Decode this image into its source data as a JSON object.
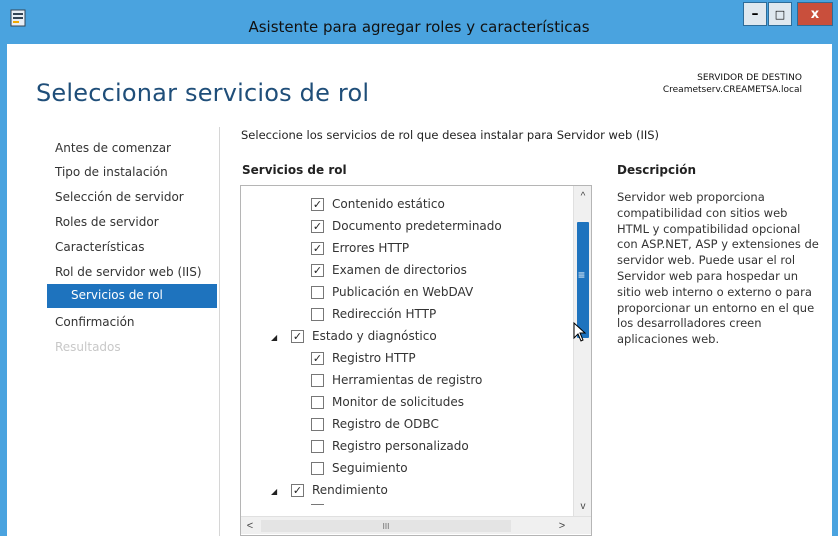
{
  "window": {
    "title": "Asistente para agregar roles y características",
    "minimize": "–",
    "maximize": "□",
    "close": "x"
  },
  "header": {
    "page_title": "Seleccionar servicios de rol",
    "destination_label": "SERVIDOR DE DESTINO",
    "destination_server": "Creametserv.CREAMETSA.local"
  },
  "nav": {
    "items": [
      {
        "label": "Antes de comenzar"
      },
      {
        "label": "Tipo de instalación"
      },
      {
        "label": "Selección de servidor"
      },
      {
        "label": "Roles de servidor"
      },
      {
        "label": "Características"
      },
      {
        "label": "Rol de servidor web (IIS)"
      },
      {
        "label": "Servicios de rol"
      },
      {
        "label": "Confirmación"
      },
      {
        "label": "Resultados"
      }
    ],
    "selected": "Servicios de rol"
  },
  "main": {
    "instruction": "Seleccione los servicios de rol que desea instalar para Servidor web (IIS)",
    "list_header": "Servicios de rol",
    "description_header": "Descripción",
    "description": "Servidor web proporciona compatibilidad con sitios web HTML y compatibilidad opcional con ASP.NET, ASP y extensiones de servidor web. Puede usar el rol Servidor web para hospedar un sitio web interno o externo o para proporcionar un entorno en el que los desarrolladores creen aplicaciones web."
  },
  "tree": {
    "rows": [
      {
        "label": "Contenido estático",
        "checked": true,
        "level": 2
      },
      {
        "label": "Documento predeterminado",
        "checked": true,
        "level": 2
      },
      {
        "label": "Errores HTTP",
        "checked": true,
        "level": 2
      },
      {
        "label": "Examen de directorios",
        "checked": true,
        "level": 2
      },
      {
        "label": "Publicación en WebDAV",
        "checked": false,
        "level": 2
      },
      {
        "label": "Redirección HTTP",
        "checked": false,
        "level": 2
      },
      {
        "label": "Estado y diagnóstico",
        "checked": true,
        "level": 1,
        "expanded": true
      },
      {
        "label": "Registro HTTP",
        "checked": true,
        "level": 2
      },
      {
        "label": "Herramientas de registro",
        "checked": false,
        "level": 2
      },
      {
        "label": "Monitor de solicitudes",
        "checked": false,
        "level": 2
      },
      {
        "label": "Registro de ODBC",
        "checked": false,
        "level": 2
      },
      {
        "label": "Registro personalizado",
        "checked": false,
        "level": 2
      },
      {
        "label": "Seguimiento",
        "checked": false,
        "level": 2
      },
      {
        "label": "Rendimiento",
        "checked": true,
        "level": 1,
        "expanded": true
      }
    ],
    "expander_glyph": "◢",
    "scroll_up": "^",
    "scroll_down": "v",
    "scroll_left": "<",
    "scroll_right": ">",
    "hthumb_grip": "III",
    "vthumb_grip": "≡"
  }
}
